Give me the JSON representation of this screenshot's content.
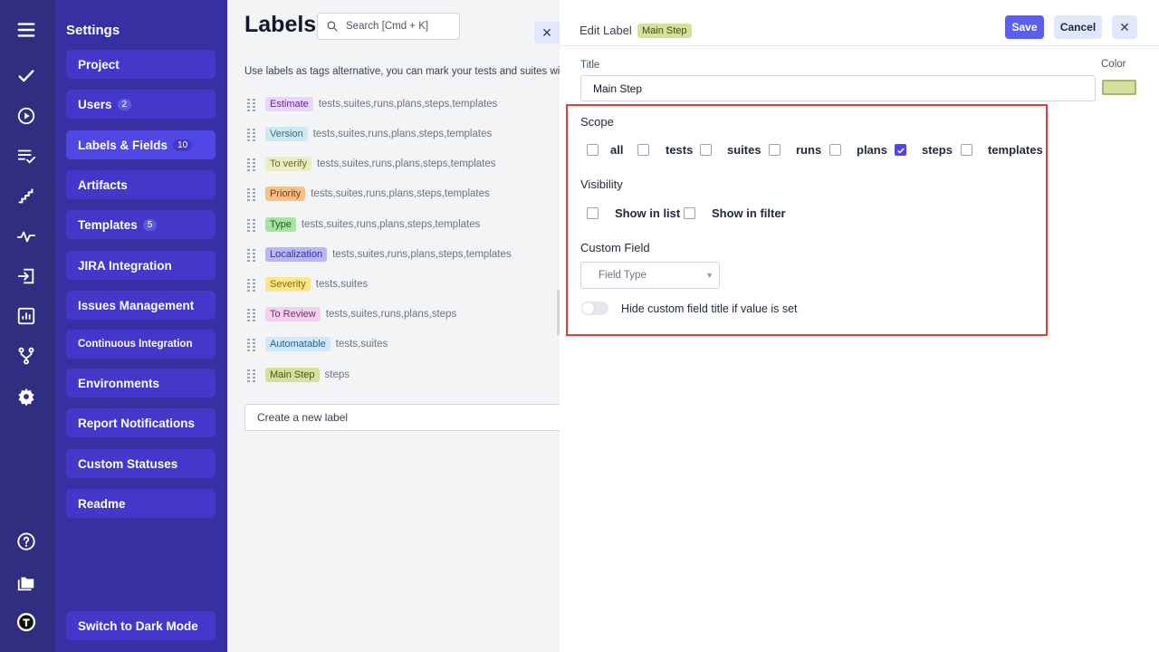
{
  "sidebar": {
    "title": "Settings",
    "items": [
      {
        "label": "Project",
        "count": ""
      },
      {
        "label": "Users",
        "count": "2"
      },
      {
        "label": "Labels & Fields",
        "count": "10"
      },
      {
        "label": "Artifacts",
        "count": ""
      },
      {
        "label": "Templates",
        "count": "5"
      },
      {
        "label": "JIRA Integration",
        "count": ""
      },
      {
        "label": "Issues Management",
        "count": ""
      },
      {
        "label": "Continuous Integration",
        "count": ""
      },
      {
        "label": "Environments",
        "count": ""
      },
      {
        "label": "Report Notifications",
        "count": ""
      },
      {
        "label": "Custom Statuses",
        "count": ""
      },
      {
        "label": "Readme",
        "count": ""
      }
    ],
    "dark_mode_label": "Switch to Dark Mode"
  },
  "rail": {
    "icons": [
      "menu-icon",
      "checkmark-icon",
      "play-circle-icon",
      "list-check-icon",
      "steps-icon",
      "pulse-icon",
      "import-icon",
      "chart-icon",
      "branch-icon",
      "gear-icon",
      "help-icon",
      "folders-icon",
      "user-avatar-icon"
    ]
  },
  "labels_pane": {
    "title": "Labels",
    "search_placeholder": "Search [Cmd + K]",
    "description": "Use labels as tags alternative, you can mark your tests and suites wit",
    "labels": [
      {
        "name": "Estimate",
        "scope": "tests,suites,runs,plans,steps,templates",
        "bg": "#e9d5ff",
        "fg": "#6b21a8"
      },
      {
        "name": "Version",
        "scope": "tests,suites,runs,plans,steps,templates",
        "bg": "#cdeaf2",
        "fg": "#3f6b78"
      },
      {
        "name": "To verify",
        "scope": "tests,suites,runs,plans,steps,templates",
        "bg": "#ebedc0",
        "fg": "#6b6b2a"
      },
      {
        "name": "Priority",
        "scope": "tests,suites,runs,plans,steps,templates",
        "bg": "#fbbf8a",
        "fg": "#7c3a10"
      },
      {
        "name": "Type",
        "scope": "tests,suites,runs,plans,steps,templates",
        "bg": "#a7e3a2",
        "fg": "#1f5e1c"
      },
      {
        "name": "Localization",
        "scope": "tests,suites,runs,plans,steps,templates",
        "bg": "#b9b6f5",
        "fg": "#3730a3"
      },
      {
        "name": "Severity",
        "scope": "tests,suites",
        "bg": "#fde68a",
        "fg": "#8a6d0b"
      },
      {
        "name": "To Review",
        "scope": "tests,suites,runs,plans,steps",
        "bg": "#f5d0ee",
        "fg": "#7a2f6b"
      },
      {
        "name": "Automatable",
        "scope": "tests,suites",
        "bg": "#cfe8fb",
        "fg": "#2c5f86"
      },
      {
        "name": "Main Step",
        "scope": "steps",
        "bg": "#d4e09b",
        "fg": "#4a5520"
      }
    ],
    "create_placeholder": "Create a new label"
  },
  "edit": {
    "title": "Edit Label",
    "badge": "Main Step",
    "save_label": "Save",
    "cancel_label": "Cancel",
    "title_field_label": "Title",
    "title_value": "Main Step",
    "color_label": "Color",
    "color_value": "#d4e09b",
    "scope_label": "Scope",
    "scope_options": [
      {
        "label": "all",
        "checked": false
      },
      {
        "label": "tests",
        "checked": false
      },
      {
        "label": "suites",
        "checked": false
      },
      {
        "label": "runs",
        "checked": false
      },
      {
        "label": "plans",
        "checked": false
      },
      {
        "label": "steps",
        "checked": true
      },
      {
        "label": "templates",
        "checked": false
      }
    ],
    "visibility_label": "Visibility",
    "visibility_options": [
      {
        "label": "Show in list",
        "checked": false
      },
      {
        "label": "Show in filter",
        "checked": false
      }
    ],
    "custom_field_label": "Custom Field",
    "field_type_placeholder": "Field Type",
    "hide_title_label": "Hide custom field title if value is set",
    "hide_title_enabled": false
  }
}
